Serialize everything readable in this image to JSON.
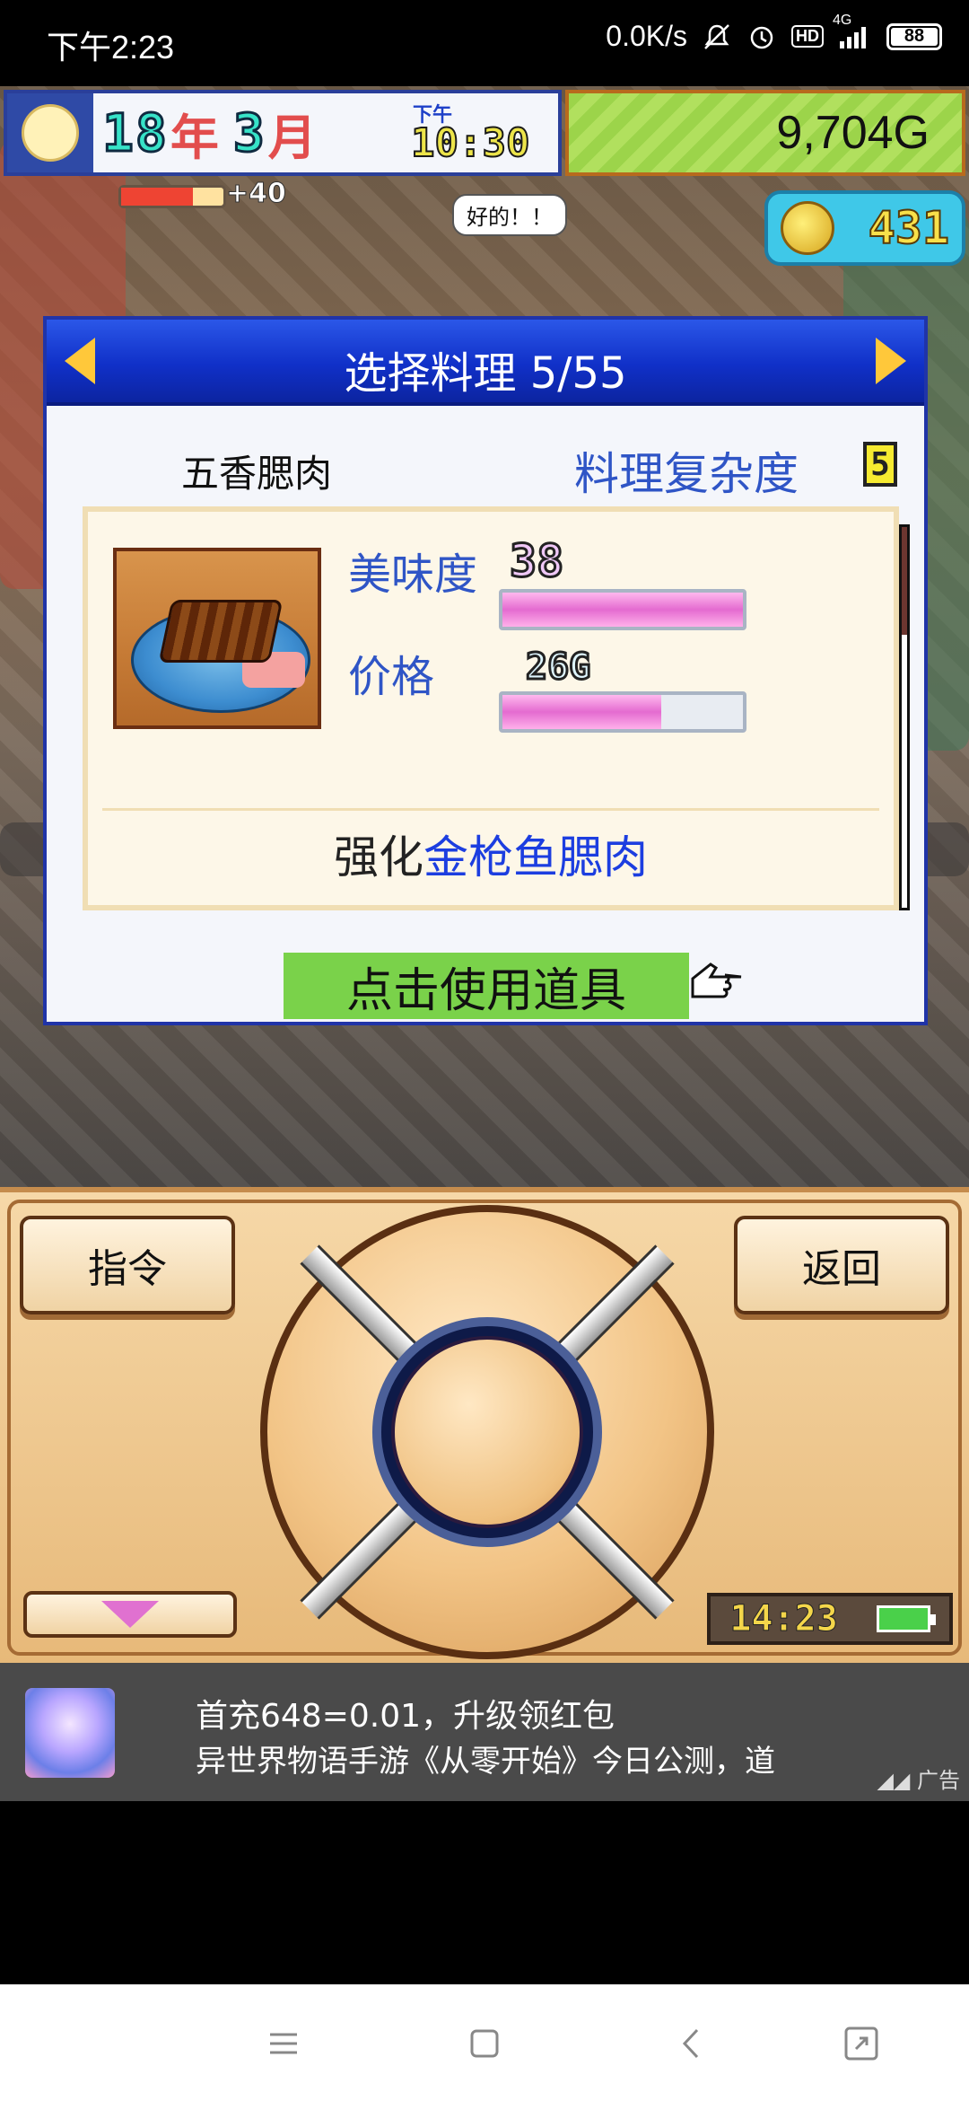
{
  "status_bar": {
    "time": "下午2:23",
    "net_speed": "0.0K/s",
    "network": "4G",
    "hd": "HD",
    "battery": "88"
  },
  "hud": {
    "year": "18",
    "year_unit": "年",
    "month": "3",
    "month_unit": "月",
    "ampm": "下午",
    "clock": "10:30",
    "money": "9,704G",
    "coins": "431",
    "sp_bonus": "+40",
    "speech": "好的！！"
  },
  "dialog": {
    "title": "选择料理 5/55",
    "dish_name": "五香腮肉",
    "complexity_label": "料理复杂度",
    "complexity_value": "5",
    "taste_label": "美味度",
    "taste_value": "38",
    "taste_fraction": 1.0,
    "price_label": "价格",
    "price_value": "26G",
    "price_fraction": 0.66,
    "enhance_prefix": "强化",
    "enhance_item": "金枪鱼腮肉",
    "use_item_button": "点击使用道具"
  },
  "controls": {
    "command_button": "指令",
    "back_button": "返回",
    "clock": "14:23"
  },
  "ad": {
    "title": "首充648=0.01，升级领红包",
    "description": "异世界物语手游《从零开始》今日公测，道",
    "tag": "广告"
  },
  "colors": {
    "dialog_header": "#1030c8",
    "bar_fill": "#e46bd0",
    "use_button": "#7ad24a",
    "accent_text": "#2f55c6"
  }
}
